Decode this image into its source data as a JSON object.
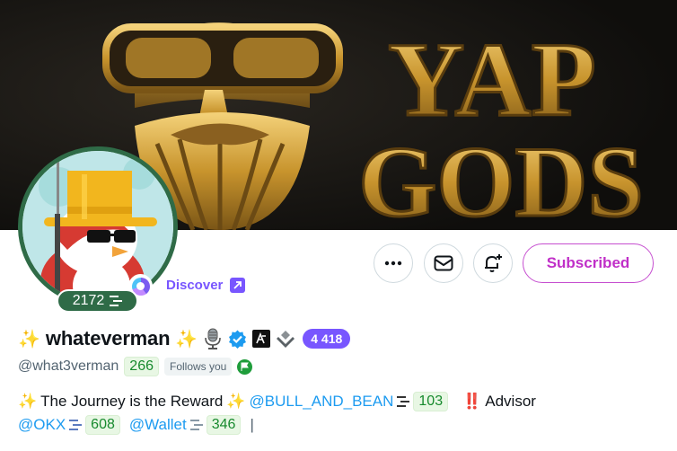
{
  "banner": {
    "text_line1": "YAP",
    "text_line2": "GODS",
    "bg_color": "#141311",
    "gold_color": "#c8942d"
  },
  "avatar": {
    "score": "2172",
    "ring_color": "#2f6b47"
  },
  "discover": {
    "label": "Discover",
    "color": "#7856ff"
  },
  "actions": {
    "subscribe_label": "Subscribed",
    "subscribe_color": "#c02fc8"
  },
  "profile": {
    "sparkle_left": "✨",
    "display_name": "whateverman",
    "sparkle_right": "✨",
    "follower_count_badge": "4 418",
    "handle": "@what3verman",
    "handle_score": "266",
    "follows_you": "Follows you"
  },
  "bio": {
    "line1": {
      "sparkle_a": "✨",
      "text": "The Journey is the Reward",
      "sparkle_b": "✨",
      "mention": "@BULL_AND_BEAN",
      "mention_score": "103",
      "alert": "‼️",
      "role": "Advisor"
    },
    "line2": {
      "mention_a": "@OKX",
      "score_a": "608",
      "mention_b": "@Wallet",
      "score_b": "346",
      "cursor": "|"
    }
  }
}
